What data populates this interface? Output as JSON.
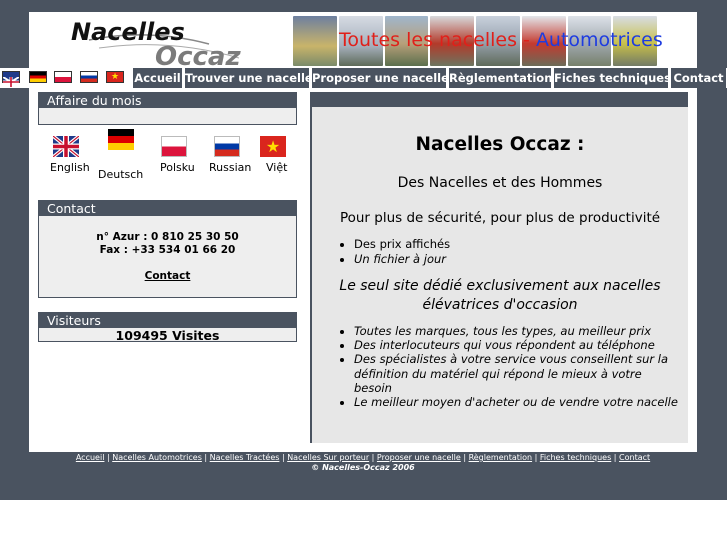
{
  "header": {
    "logo_line1": "Nacelles",
    "logo_line2": "Occaz",
    "banner_part1": "Toutes les nacelles - ",
    "banner_part2": "Automotrices",
    "banner_colors": {
      "part1": "#e0201a",
      "part2": "#1e3ce0"
    }
  },
  "nav": {
    "flags": [
      "flag-uk-icon",
      "flag-germany-icon",
      "flag-poland-icon",
      "flag-russia-icon",
      "flag-vietnam-icon"
    ],
    "items": [
      {
        "label": "Accueil"
      },
      {
        "label": "Trouver une nacelle"
      },
      {
        "label": "Proposer une nacelle"
      },
      {
        "label": "Règlementation"
      },
      {
        "label": "Fiches techniques"
      },
      {
        "label": "Contact"
      }
    ]
  },
  "affaire": {
    "title": "Affaire du mois"
  },
  "languages": [
    {
      "label": "English",
      "icon": "flag-uk-icon"
    },
    {
      "label": "Deutsch",
      "icon": "flag-germany-icon"
    },
    {
      "label": "Polsku",
      "icon": "flag-poland-icon"
    },
    {
      "label": "Russian",
      "icon": "flag-russia-icon"
    },
    {
      "label": "Việt",
      "icon": "flag-vietnam-icon"
    }
  ],
  "contact": {
    "title": "Contact",
    "azur": "n° Azur : 0 810 25 30 50",
    "fax": "Fax : +33 534 01 66 20",
    "link": "Contact"
  },
  "visitors": {
    "title": "Visiteurs",
    "count_text": "109495 Visites"
  },
  "main": {
    "heading": "Nacelles Occaz :",
    "subheading": "Des Nacelles et des Hommes",
    "tagline": "Pour plus de sécurité, pour plus de productivité",
    "bullets1": [
      "Des prix affichés",
      "Un fichier à jour"
    ],
    "highlight": "Le seul site dédié exclusivement aux nacelles élévatrices d'occasion",
    "bullets2": [
      "Toutes les marques, tous les types, au meilleur prix",
      "Des interlocuteurs qui vous répondent au téléphone",
      "Des spécialistes à votre service vous conseillent sur la définition du matériel qui répond le mieux à votre besoin",
      "Le meilleur moyen d'acheter ou de vendre votre nacelle"
    ]
  },
  "footer": {
    "links": [
      "Accueil",
      "Nacelles Automotrices",
      "Nacelles Tractées",
      "Nacelles Sur porteur",
      "Proposer une nacelle",
      "Règlementation",
      "Fiches techniques",
      "Contact"
    ],
    "separator": " | ",
    "copyright": "© Nacelles-Occaz 2006"
  }
}
